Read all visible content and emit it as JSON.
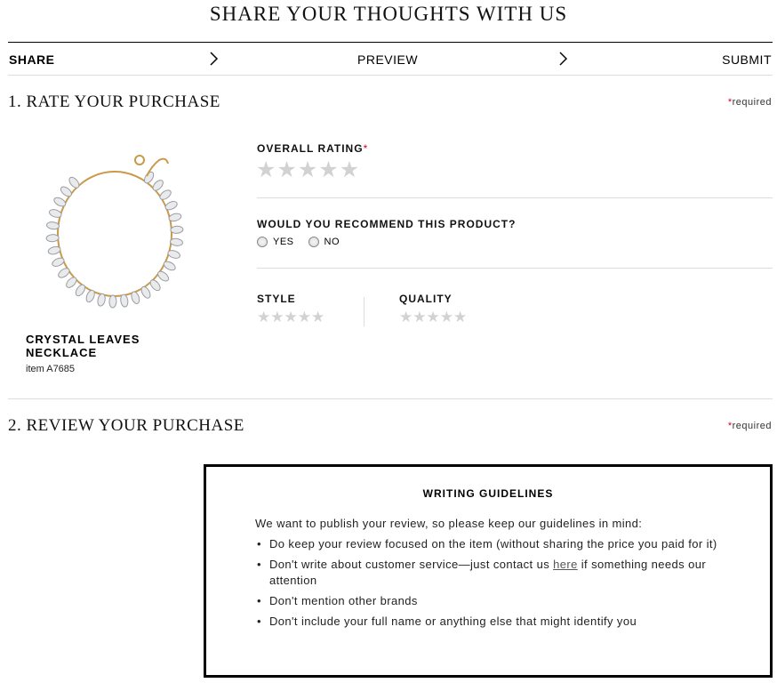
{
  "page": {
    "title": "SHARE YOUR THOUGHTS WITH US"
  },
  "steps": [
    {
      "label": "SHARE"
    },
    {
      "label": "PREVIEW"
    },
    {
      "label": "SUBMIT"
    }
  ],
  "section1": {
    "heading": "1. RATE YOUR PURCHASE",
    "required_marker": "*",
    "required_label": "required"
  },
  "product": {
    "name": "CRYSTAL LEAVES NECKLACE",
    "item_number": "item A7685"
  },
  "overall_rating": {
    "label": "OVERALL RATING",
    "required_marker": "*",
    "value": 0,
    "max": 5
  },
  "recommend": {
    "question": "WOULD YOU RECOMMEND THIS PRODUCT?",
    "options": [
      "YES",
      "NO"
    ]
  },
  "style_rating": {
    "label": "STYLE",
    "value": 0,
    "max": 5
  },
  "quality_rating": {
    "label": "QUALITY",
    "value": 0,
    "max": 5
  },
  "section2": {
    "heading": "2. REVIEW YOUR PURCHASE",
    "required_marker": "*",
    "required_label": "required"
  },
  "guidelines": {
    "title": "WRITING GUIDELINES",
    "intro": "We want to publish your review, so please keep our guidelines in mind:",
    "item1": "Do keep your review focused on the item (without sharing the price you paid for it)",
    "item2_before": "Don't write about customer service—just contact us ",
    "item2_link": "here",
    "item2_after": " if something needs our attention",
    "item3": "Don't mention other brands",
    "item4": "Don't include your full name or anything else that might identify you"
  },
  "colors": {
    "required": "#d0021b",
    "star_empty": "#d2d2d2",
    "rule": "#dddddd"
  },
  "icons": {
    "step_separator": "chevron-right-icon",
    "star": "star-icon"
  }
}
